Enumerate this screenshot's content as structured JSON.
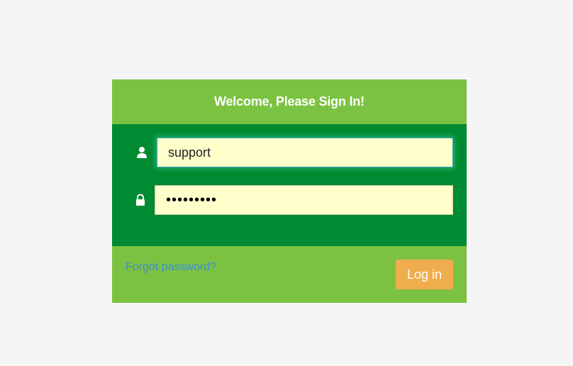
{
  "login": {
    "title": "Welcome, Please Sign In!",
    "username": {
      "icon": "user-icon",
      "value": "support"
    },
    "password": {
      "icon": "lock-icon",
      "value": "•••••••••"
    },
    "forgot_label": "Forgot password?",
    "submit_label": "Log in"
  },
  "colors": {
    "header_bg": "#7cc242",
    "body_bg": "#008a31",
    "field_bg": "#ffffcc",
    "button_bg": "#efad4d",
    "link": "#3d8fcf"
  }
}
